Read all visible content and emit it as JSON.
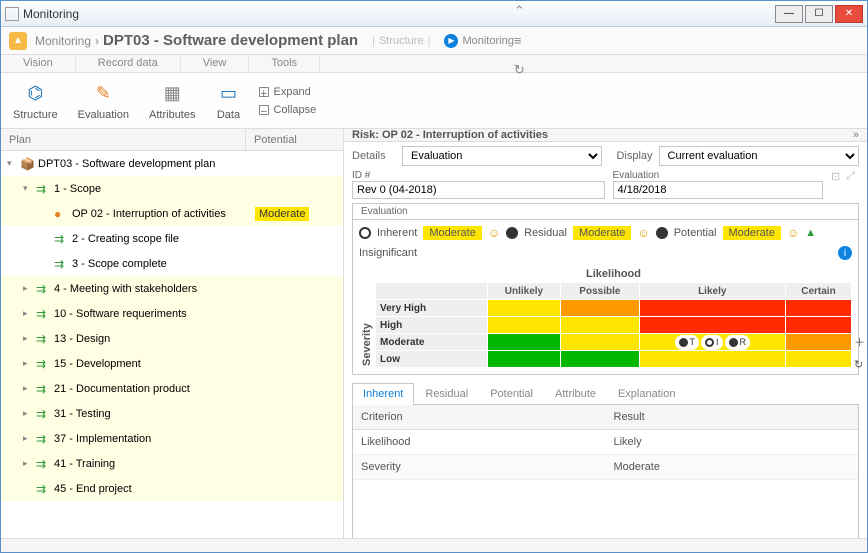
{
  "window": {
    "title": "Monitoring"
  },
  "breadcrumb": {
    "root": "Monitoring",
    "sep": "›",
    "main": "DPT03 - Software development plan",
    "structure": "Structure",
    "monitoring": "Monitoring"
  },
  "ribbon_tabs": [
    "Vision",
    "Record data",
    "View",
    "Tools"
  ],
  "ribbon": {
    "structure": "Structure",
    "evaluation": "Evaluation",
    "attributes": "Attributes",
    "data": "Data",
    "expand": "Expand",
    "collapse": "Collapse"
  },
  "left_cols": {
    "plan": "Plan",
    "potential": "Potential"
  },
  "tree": [
    {
      "lvl": 1,
      "open": "▾",
      "icon": "📦",
      "label": "DPT03 - Software development plan"
    },
    {
      "lvl": 2,
      "open": "▾",
      "icon": "⇉",
      "label": "1 - Scope",
      "hilite": true
    },
    {
      "lvl": 3,
      "open": "",
      "icon": "●",
      "label": "OP 02 - Interruption of activities",
      "potential": "Moderate",
      "sel": true,
      "orange": true
    },
    {
      "lvl": 3,
      "open": "",
      "icon": "⇉",
      "label": "2 - Creating scope file"
    },
    {
      "lvl": 3,
      "open": "",
      "icon": "⇉",
      "label": "3 - Scope complete"
    },
    {
      "lvl": 2,
      "open": "▸",
      "icon": "⇉",
      "label": "4 - Meeting with stakeholders"
    },
    {
      "lvl": 2,
      "open": "▸",
      "icon": "⇉",
      "label": "10 - Software requeriments"
    },
    {
      "lvl": 2,
      "open": "▸",
      "icon": "⇉",
      "label": "13 - Design"
    },
    {
      "lvl": 2,
      "open": "▸",
      "icon": "⇉",
      "label": "15 - Development"
    },
    {
      "lvl": 2,
      "open": "▸",
      "icon": "⇉",
      "label": "21 - Documentation product"
    },
    {
      "lvl": 2,
      "open": "▸",
      "icon": "⇉",
      "label": "31 - Testing"
    },
    {
      "lvl": 2,
      "open": "▸",
      "icon": "⇉",
      "label": "37 - Implementation"
    },
    {
      "lvl": 2,
      "open": "▸",
      "icon": "⇉",
      "label": "41 - Training"
    },
    {
      "lvl": 2,
      "open": "",
      "icon": "⇉",
      "label": "45 - End project"
    }
  ],
  "risk": {
    "title": "Risk: OP 02 - Interruption of activities",
    "details_label": "Details",
    "details_value": "Evaluation",
    "display_label": "Display",
    "display_value": "Current evaluation",
    "id_label": "ID #",
    "id_value": "Rev 0 (04-2018)",
    "eval_label": "Evaluation",
    "eval_value": "4/18/2018",
    "eval_tab": "Evaluation",
    "summary": {
      "inherent": {
        "label": "Inherent",
        "value": "Moderate"
      },
      "residual": {
        "label": "Residual",
        "value": "Moderate"
      },
      "potential": {
        "label": "Potential",
        "value": "Moderate"
      },
      "insignificant": "Insignificant"
    },
    "matrix": {
      "title": "Likelihood",
      "severity": "Severity",
      "cols": [
        "Unlikely",
        "Possible",
        "Likely",
        "Certain"
      ],
      "rows": [
        "Very High",
        "High",
        "Moderate",
        "Low"
      ]
    },
    "tabs": [
      "Inherent",
      "Residual",
      "Potential",
      "Attribute",
      "Explanation"
    ],
    "criteria": {
      "head_c": "Criterion",
      "head_r": "Result",
      "rows": [
        {
          "c": "Likelihood",
          "r": "Likely"
        },
        {
          "c": "Severity",
          "r": "Moderate"
        }
      ]
    }
  },
  "chart_data": {
    "type": "heatmap",
    "title": "Likelihood",
    "xlabel": "Likelihood",
    "ylabel": "Severity",
    "x": [
      "Unlikely",
      "Possible",
      "Likely",
      "Certain"
    ],
    "y": [
      "Very High",
      "High",
      "Moderate",
      "Low"
    ],
    "values": [
      [
        "yellow",
        "orange",
        "red",
        "red"
      ],
      [
        "yellow",
        "yellow",
        "red",
        "red"
      ],
      [
        "green",
        "yellow",
        "yellow",
        "orange"
      ],
      [
        "green",
        "green",
        "yellow",
        "yellow"
      ]
    ],
    "markers": [
      {
        "x": "Likely",
        "y": "Moderate",
        "labels": [
          "T",
          "I",
          "R"
        ]
      }
    ]
  }
}
